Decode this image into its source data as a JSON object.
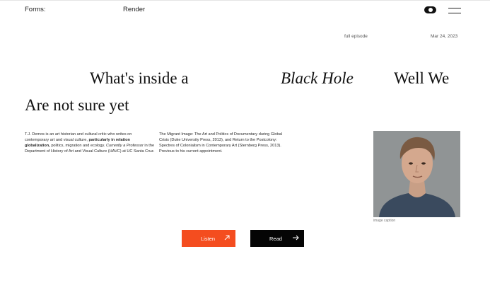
{
  "nav": {
    "left_label": "Forms:",
    "mid_label": "Render"
  },
  "meta": {
    "episode": "full episode",
    "date": "Mar 24, 2023"
  },
  "headline": {
    "part1": "What's inside a",
    "part2": "Black Hole",
    "part3": "Well We",
    "part4": "Are not sure yet"
  },
  "bio": {
    "col1": {
      "a": "T.J. Demos is an art historian and cultural critic who writes on contemporary art and visual culture,",
      "b": "particularly in relation globalization,",
      "c": "politics, migration and ecology.",
      "d": "Currently a Professor",
      "e": "in the Department of History of Art and Visual Culture (HAVC) at UC Santa Cruz."
    },
    "col2": "The Migrant Image: The Art and Politics of Documentary during Global Crisis (Duke University Press, 2013), and Return to the Postcolony: Spectres of Colonialism in Contemporary Art (Sternberg Press, 2013). Previous to his current appointment."
  },
  "image": {
    "caption": "image caption"
  },
  "buttons": {
    "listen": "Listen",
    "read": "Read"
  },
  "icons": {
    "theme_toggle": "toggle-icon",
    "menu": "hamburger-menu-icon",
    "listen_arrow": "arrow-up-right-icon",
    "read_arrow": "arrow-right-icon"
  },
  "colors": {
    "accent": "#f44d1f",
    "dark": "#050505"
  }
}
